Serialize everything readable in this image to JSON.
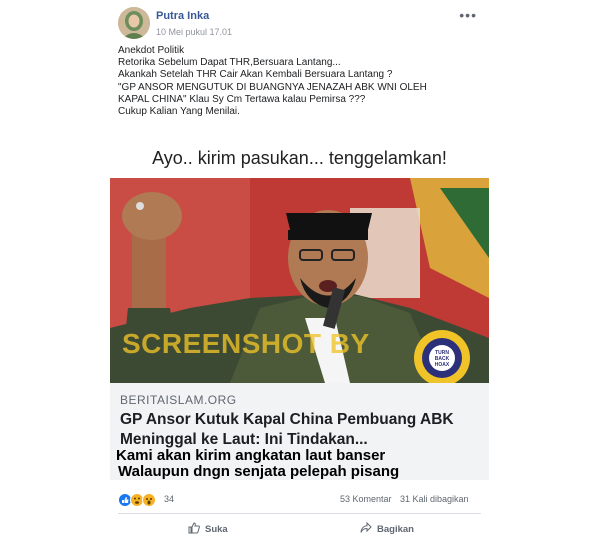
{
  "post": {
    "author": "Putra Inka",
    "timestamp": "10 Mei pukul 17.01",
    "more_icon": "more-horizontal-icon",
    "text_lines": [
      "Anekdot Politik",
      "Retorika Sebelum Dapat THR,Bersuara Lantang...",
      "Akankah Setelah THR Cair Akan Kembali Bersuara Lantang ?",
      "\"GP ANSOR MENGUTUK DI BUANGNYA JENAZAH ABK WNI OLEH",
      "KAPAL CHINA\" Klau Sy Cm Tertawa kalau Pemirsa ???",
      "Cukup Kalian Yang Menilai."
    ]
  },
  "image": {
    "headline": "Ayo.. kirim pasukan... tenggelamkan!",
    "watermark": "SCREENSHOT BY",
    "badge_text": "TURN BACK HOAX",
    "site": "BERITAISLAM.ORG",
    "link_title": "GP Ansor Kutuk Kapal China Pembuang ABK Meninggal ke Laut: Ini Tindakan...",
    "caption_lines": [
      "Kami akan kirim angkatan laut banser",
      "Walaupun dngn senjata pelepah pisang"
    ]
  },
  "stats": {
    "reaction_count": "34",
    "comments": "53 Komentar",
    "shares": "31 Kali dibagikan"
  },
  "actions": {
    "like": "Suka",
    "share": "Bagikan"
  },
  "colors": {
    "author_link": "#385898",
    "watermark": "#f0c328",
    "photo_background": "#c43232"
  }
}
